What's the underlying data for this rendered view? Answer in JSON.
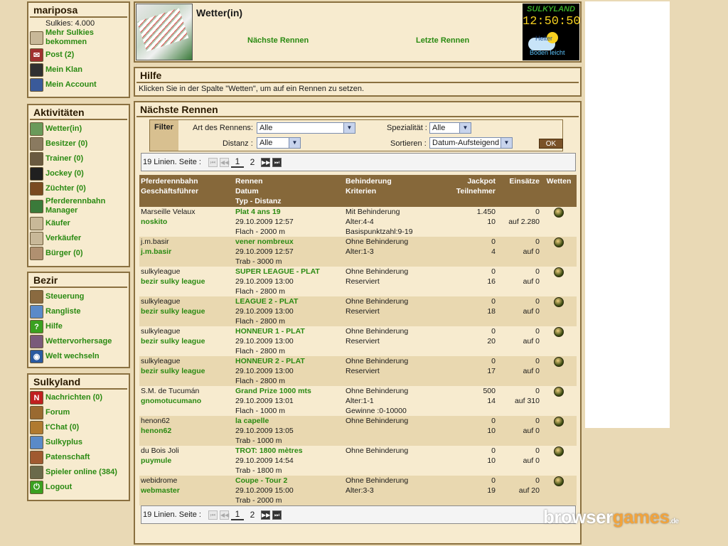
{
  "user": {
    "name": "mariposa",
    "sulkies": "Sulkies: 4.000",
    "items": [
      {
        "label": "Mehr Sulkies bekommen",
        "icon": "coin-icon"
      },
      {
        "label": "Post (2)",
        "icon": "mail-icon"
      },
      {
        "label": "Mein Klan",
        "icon": "horseshoe-icon"
      },
      {
        "label": "Mein Account",
        "icon": "account-icon"
      }
    ]
  },
  "activities": {
    "title": "Aktivitäten",
    "items": [
      {
        "label": "Wetter(in)",
        "icon": "betting-icon"
      },
      {
        "label": "Besitzer (0)",
        "icon": "owner-icon"
      },
      {
        "label": "Trainer (0)",
        "icon": "trainer-icon"
      },
      {
        "label": "Jockey (0)",
        "icon": "jockey-icon"
      },
      {
        "label": "Züchter (0)",
        "icon": "breeder-icon"
      },
      {
        "label": "Pferderennbahn Manager",
        "icon": "racetrack-icon"
      },
      {
        "label": "Käufer",
        "icon": "buyer-icon"
      },
      {
        "label": "Verkäufer",
        "icon": "seller-icon"
      },
      {
        "label": "Bürger (0)",
        "icon": "citizen-icon"
      }
    ]
  },
  "district": {
    "title": "Bezir",
    "items": [
      {
        "label": "Steuerung",
        "icon": "control-icon"
      },
      {
        "label": "Rangliste",
        "icon": "ranking-icon"
      },
      {
        "label": "Hilfe",
        "icon": "help-icon"
      },
      {
        "label": "Wettervorhersage",
        "icon": "weather-icon"
      },
      {
        "label": "Welt wechseln",
        "icon": "globe-icon"
      }
    ]
  },
  "sulkyland": {
    "title": "Sulkyland",
    "items": [
      {
        "label": "Nachrichten (0)",
        "icon": "news-icon"
      },
      {
        "label": "Forum",
        "icon": "forum-icon"
      },
      {
        "label": "t'Chat (0)",
        "icon": "chat-icon"
      },
      {
        "label": "Sulkyplus",
        "icon": "plus-icon"
      },
      {
        "label": "Patenschaft",
        "icon": "sponsor-icon"
      },
      {
        "label": "Spieler online (384)",
        "icon": "players-icon"
      },
      {
        "label": "Logout",
        "icon": "power-icon"
      }
    ]
  },
  "header": {
    "title": "Wetter(in)",
    "nav_next": "Nächste Rennen",
    "nav_last": "Letzte Rennen",
    "logo_text": "SULKYLAND",
    "clock": "12:50:50",
    "weather_text": "Heiter",
    "track_text": "Boden leicht"
  },
  "help": {
    "title": "Hilfe",
    "text": "Klicken Sie in der Spalte \"Wetten\", um auf ein Rennen zu setzen."
  },
  "races": {
    "title": "Nächste Rennen",
    "filter": {
      "title": "Filter",
      "art_label": "Art des Rennens:",
      "art_value": "Alle",
      "spezial_label": "Spezialität :",
      "spezial_value": "Alle",
      "distanz_label": "Distanz :",
      "distanz_value": "Alle",
      "sort_label": "Sortieren :",
      "sort_value": "Datum-Aufsteigend",
      "ok": "OK"
    },
    "pager": {
      "text": "19 Linien. Seite :",
      "pages": [
        "1",
        "2"
      ]
    },
    "headers": {
      "c1": "Pferderennbahn\nGeschäftsführer",
      "c2": "Rennen\nDatum\nTyp - Distanz",
      "c3": "Behinderung\nKriterien",
      "c4": "Jackpot\nTeilnehmer",
      "c5": "Einsätze",
      "c6": "Wetten"
    },
    "rows": [
      {
        "track": "Marseille Velaux",
        "manager": "noskito",
        "race": "Plat 4 ans 19",
        "date": "29.10.2009 12:57",
        "type": "Flach - 2000 m",
        "handicap": "Mit Behinderung",
        "crit1": "Alter:4-4",
        "crit2": "Basispunktzahl:9-19",
        "jackpot": "1.450",
        "runners": "10",
        "stakes": "0",
        "stakes2": "auf 2.280"
      },
      {
        "track": "j.m.basir",
        "manager": "j.m.basir",
        "race": "vener nombreux",
        "date": "29.10.2009 12:57",
        "type": "Trab - 3000 m",
        "handicap": "Ohne Behinderung",
        "crit1": "Alter:1-3",
        "crit2": "",
        "jackpot": "0",
        "runners": "4",
        "stakes": "0",
        "stakes2": "auf 0"
      },
      {
        "track": "sulkyleague",
        "manager": "bezir sulky league",
        "race": "SUPER LEAGUE - PLAT",
        "date": "29.10.2009 13:00",
        "type": "Flach - 2800 m",
        "handicap": "Ohne Behinderung",
        "crit1": "Reserviert",
        "crit2": "",
        "jackpot": "0",
        "runners": "16",
        "stakes": "0",
        "stakes2": "auf 0"
      },
      {
        "track": "sulkyleague",
        "manager": "bezir sulky league",
        "race": "LEAGUE 2 - PLAT",
        "date": "29.10.2009 13:00",
        "type": "Flach - 2800 m",
        "handicap": "Ohne Behinderung",
        "crit1": "Reserviert",
        "crit2": "",
        "jackpot": "0",
        "runners": "18",
        "stakes": "0",
        "stakes2": "auf 0"
      },
      {
        "track": "sulkyleague",
        "manager": "bezir sulky league",
        "race": "HONNEUR 1 - PLAT",
        "date": "29.10.2009 13:00",
        "type": "Flach - 2800 m",
        "handicap": "Ohne Behinderung",
        "crit1": "Reserviert",
        "crit2": "",
        "jackpot": "0",
        "runners": "20",
        "stakes": "0",
        "stakes2": "auf 0"
      },
      {
        "track": "sulkyleague",
        "manager": "bezir sulky league",
        "race": "HONNEUR 2 - PLAT",
        "date": "29.10.2009 13:00",
        "type": "Flach - 2800 m",
        "handicap": "Ohne Behinderung",
        "crit1": "Reserviert",
        "crit2": "",
        "jackpot": "0",
        "runners": "17",
        "stakes": "0",
        "stakes2": "auf 0"
      },
      {
        "track": "S.M. de Tucumán",
        "manager": "gnomotucumano",
        "race": "Grand Prize 1000 mts",
        "date": "29.10.2009 13:01",
        "type": "Flach - 1000 m",
        "handicap": "Ohne Behinderung",
        "crit1": "Alter:1-1",
        "crit2": "Gewinne :0-10000",
        "jackpot": "500",
        "runners": "14",
        "stakes": "0",
        "stakes2": "auf 310"
      },
      {
        "track": "henon62",
        "manager": "henon62",
        "race": "la capelle",
        "date": "29.10.2009 13:05",
        "type": "Trab - 1000 m",
        "handicap": "Ohne Behinderung",
        "crit1": "",
        "crit2": "",
        "jackpot": "0",
        "runners": "10",
        "stakes": "0",
        "stakes2": "auf 0"
      },
      {
        "track": "du Bois Joli",
        "manager": "puymule",
        "race": "TROT: 1800 mètres",
        "date": "29.10.2009 14:54",
        "type": "Trab - 1800 m",
        "handicap": "Ohne Behinderung",
        "crit1": "",
        "crit2": "",
        "jackpot": "0",
        "runners": "10",
        "stakes": "0",
        "stakes2": "auf 0"
      },
      {
        "track": "webidrome",
        "manager": "webmaster",
        "race": "Coupe - Tour 2",
        "date": "29.10.2009 15:00",
        "type": "Trab - 2000 m",
        "handicap": "Ohne Behinderung",
        "crit1": "Alter:3-3",
        "crit2": "",
        "jackpot": "0",
        "runners": "19",
        "stakes": "0",
        "stakes2": "auf 20"
      }
    ]
  },
  "watermark": {
    "a": "browser",
    "b": "games",
    "c": ".de"
  },
  "colors": {
    "accent": "#2a8a12",
    "border": "#8a7040",
    "panel": "#f7ebcf",
    "header": "#86683a"
  }
}
